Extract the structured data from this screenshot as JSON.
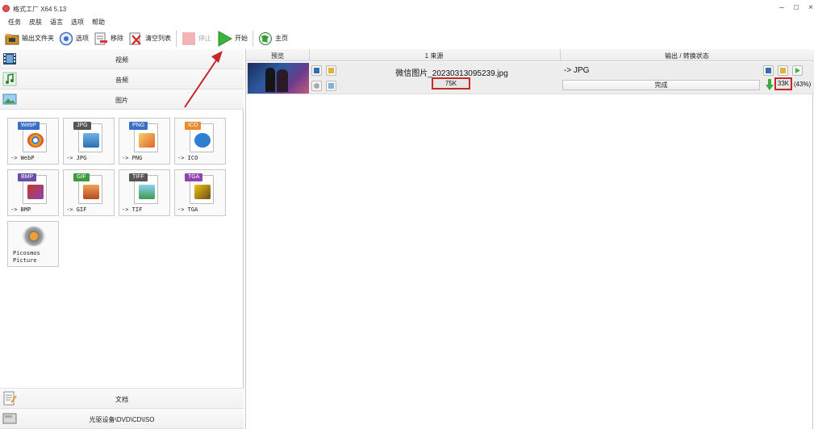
{
  "window": {
    "title": "格式工厂 X64 5.13",
    "controls": [
      "–",
      "□",
      "×"
    ]
  },
  "menu": [
    "任务",
    "皮肤",
    "语言",
    "选项",
    "帮助"
  ],
  "toolbar": {
    "output_folder": "输出文件夹",
    "options": "选项",
    "remove": "移除",
    "clear_list": "清空列表",
    "stop": "停止",
    "start": "开始",
    "home": "主页"
  },
  "sidebar": {
    "categories": {
      "video": "视频",
      "audio": "音频",
      "image": "图片",
      "document": "文档",
      "disc": "光驱设备\\DVD\\CD\\ISO"
    },
    "tiles": [
      {
        "badge": "WebP",
        "label": "-> WebP"
      },
      {
        "badge": "JPG",
        "label": "-> JPG"
      },
      {
        "badge": "PNG",
        "label": "-> PNG"
      },
      {
        "badge": "ICO",
        "label": "-> ICO"
      },
      {
        "badge": "BMP",
        "label": "-> BMP"
      },
      {
        "badge": "GIF",
        "label": "-> GIF"
      },
      {
        "badge": "TIFF",
        "label": "-> TIF"
      },
      {
        "badge": "TGA",
        "label": "-> TGA"
      }
    ],
    "picosmos": {
      "line1": "Picosmos",
      "line2": "Picture"
    }
  },
  "list": {
    "headers": {
      "preview": "预览",
      "source": "1 来源",
      "output": "输出 / 转换状态"
    },
    "row": {
      "filename": "微信图片_20230313095239.jpg",
      "source_size": "75K",
      "output_type": "-> JPG",
      "status": "完成",
      "output_size": "33K",
      "ratio": "(43%)"
    }
  }
}
